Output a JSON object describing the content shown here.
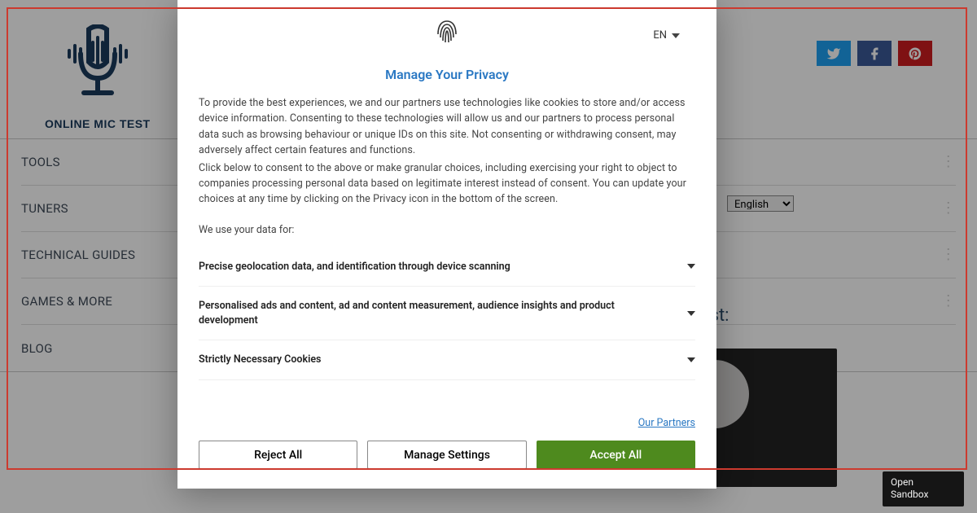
{
  "header": {
    "logo_text": "ONLINE MIC TEST"
  },
  "nav": {
    "items": [
      {
        "label": "TOOLS",
        "expandable": true
      },
      {
        "label": "TUNERS",
        "expandable": true
      },
      {
        "label": "TECHNICAL GUIDES",
        "expandable": true
      },
      {
        "label": "GAMES & MORE",
        "expandable": true
      },
      {
        "label": "BLOG",
        "expandable": false
      }
    ]
  },
  "language_select": {
    "value": "English"
  },
  "main": {
    "heading": "An online mic test:"
  },
  "modal": {
    "lang_badge": "EN",
    "title": "Manage Your Privacy",
    "paragraph1": "To provide the best experiences, we and our partners use technologies like cookies to store and/or access device information. Consenting to these technologies will allow us and our partners to process personal data such as browsing behaviour or unique IDs on this site. Not consenting or withdrawing consent, may adversely affect certain features and functions.",
    "paragraph2": "Click below to consent to the above or make granular choices, including exercising your right to object to companies processing personal data based on legitimate interest instead of consent. You can update your choices at any time by clicking on the Privacy icon in the bottom of the screen.",
    "use_label": "We use your data for:",
    "sections": [
      {
        "label": "Precise geolocation data, and identification through device scanning"
      },
      {
        "label": "Personalised ads and content, ad and content measurement, audience insights and product development"
      },
      {
        "label": "Strictly Necessary Cookies"
      }
    ],
    "partners_link": "Our Partners",
    "buttons": {
      "reject": "Reject All",
      "manage": "Manage Settings",
      "accept": "Accept All"
    }
  },
  "sandbox": {
    "line1": "Open",
    "line2": "Sandbox"
  }
}
